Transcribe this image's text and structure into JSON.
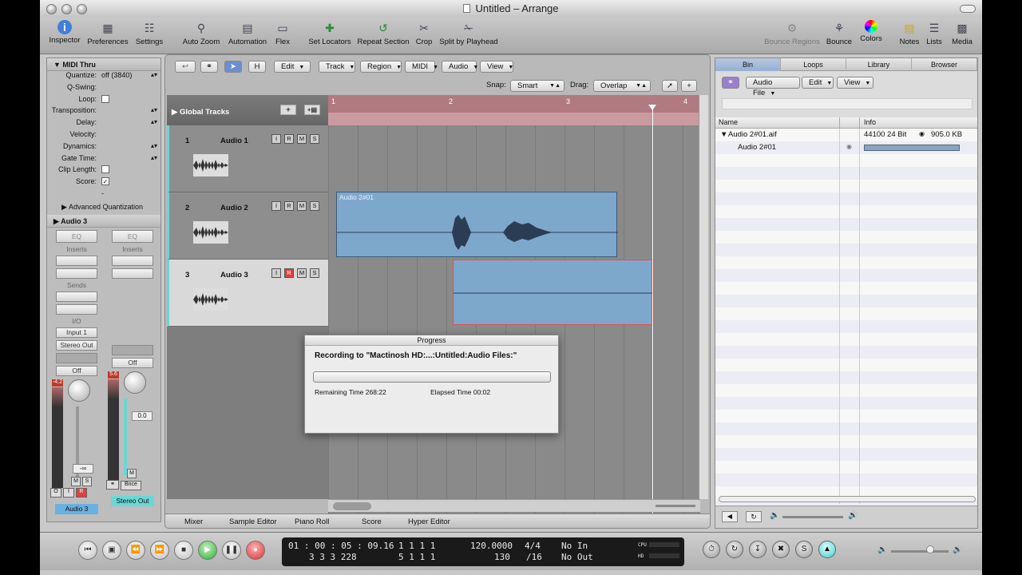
{
  "window": {
    "title": "Untitled – Arrange"
  },
  "toolbar": {
    "items": [
      {
        "label": "Inspector",
        "icon": "info-icon"
      },
      {
        "label": "Preferences",
        "icon": "switch-icon"
      },
      {
        "label": "Settings",
        "icon": "sliders-icon"
      },
      {
        "label": "Auto Zoom",
        "icon": "magnifier-icon"
      },
      {
        "label": "Automation",
        "icon": "automation-icon"
      },
      {
        "label": "Flex",
        "icon": "flex-icon"
      },
      {
        "label": "Set Locators",
        "icon": "locator-icon"
      },
      {
        "label": "Repeat Section",
        "icon": "repeat-icon"
      },
      {
        "label": "Crop",
        "icon": "crop-icon"
      },
      {
        "label": "Split by Playhead",
        "icon": "scissors-icon"
      },
      {
        "label": "Bounce Regions",
        "icon": "bounce-regions-icon"
      },
      {
        "label": "Bounce",
        "icon": "bounce-icon"
      },
      {
        "label": "Colors",
        "icon": "color-wheel-icon"
      },
      {
        "label": "Notes",
        "icon": "notes-icon"
      },
      {
        "label": "Lists",
        "icon": "lists-icon"
      },
      {
        "label": "Media",
        "icon": "media-icon"
      }
    ]
  },
  "inspector": {
    "header": "MIDI Thru",
    "params": [
      {
        "key": "Quantize:",
        "value": "off (3840)",
        "type": "select"
      },
      {
        "key": "Q-Swing:",
        "value": "",
        "type": "text"
      },
      {
        "key": "Loop:",
        "value": "",
        "type": "checkbox"
      },
      {
        "key": "Transposition:",
        "value": "",
        "type": "select"
      },
      {
        "key": "Delay:",
        "value": "",
        "type": "select"
      },
      {
        "key": "Velocity:",
        "value": "",
        "type": "text"
      },
      {
        "key": "Dynamics:",
        "value": "",
        "type": "select"
      },
      {
        "key": "Gate Time:",
        "value": "",
        "type": "select"
      },
      {
        "key": "Clip Length:",
        "value": "",
        "type": "checkbox"
      },
      {
        "key": "Score:",
        "value": "✓",
        "type": "checkbox"
      },
      {
        "key": "",
        "value": "-",
        "type": "text"
      }
    ],
    "advanced": "Advanced Quantization",
    "track": "Audio 3",
    "strip_left": {
      "eq": "EQ",
      "inserts": "Inserts",
      "sends": "Sends",
      "io": "I/O",
      "input": "Input 1",
      "output": "Stereo Out",
      "auto": "Off",
      "peak": "-4.2",
      "fader": "-∞",
      "name": "Audio 3"
    },
    "strip_right": {
      "eq": "EQ",
      "inserts": "Inserts",
      "auto": "Off",
      "peak": "5.6",
      "fader": "0.0",
      "bnce": "Bnce",
      "name": "Stereo Out"
    }
  },
  "arrange": {
    "menus": [
      "Edit",
      "Track",
      "Region",
      "MIDI",
      "Audio",
      "View"
    ],
    "snap_label": "Snap:",
    "snap_value": "Smart",
    "drag_label": "Drag:",
    "drag_value": "Overlap",
    "global_tracks": "Global Tracks",
    "ruler": [
      "1",
      "2",
      "3",
      "4"
    ],
    "tracks": [
      {
        "num": "1",
        "name": "Audio 1"
      },
      {
        "num": "2",
        "name": "Audio 2"
      },
      {
        "num": "3",
        "name": "Audio 3"
      }
    ],
    "region_name": "Audio 2#01",
    "bottom_tabs": [
      "Mixer",
      "Sample Editor",
      "Piano Roll",
      "Score",
      "Hyper Editor"
    ]
  },
  "progress": {
    "title": "Progress",
    "message": "Recording to \"Mactinosh HD:...:Untitled:Audio Files:\"",
    "remaining": "Remaining Time 268:22",
    "elapsed": "Elapsed Time 00:02",
    "fraction": 0.0
  },
  "media": {
    "tabs": [
      "Bin",
      "Loops",
      "Library",
      "Browser"
    ],
    "audio_file": "Audio File",
    "edit": "Edit",
    "view": "View",
    "col_name": "Name",
    "col_info": "Info",
    "file": "Audio 2#01.aif",
    "file_info": "44100 24 Bit",
    "file_size": "905.0 KB",
    "region": "Audio 2#01"
  },
  "transport": {
    "smpte": "01 : 00 : 05 : 09.16",
    "bars": "3   3   3 228",
    "pos_top": "1     1     1     1",
    "pos_bottom": "5     1     1     1",
    "tempo": "120.0000",
    "tempo2": "130",
    "sig": "4/4",
    "div": "/16",
    "in": "No In",
    "out": "No Out",
    "cpu": "CPU",
    "hd": "HD"
  },
  "colors": {
    "accent": "#6ad7d7",
    "region": "#7ea7cc",
    "ruler": "#b07a80",
    "record": "#e03030",
    "play": "#2fb02f"
  }
}
